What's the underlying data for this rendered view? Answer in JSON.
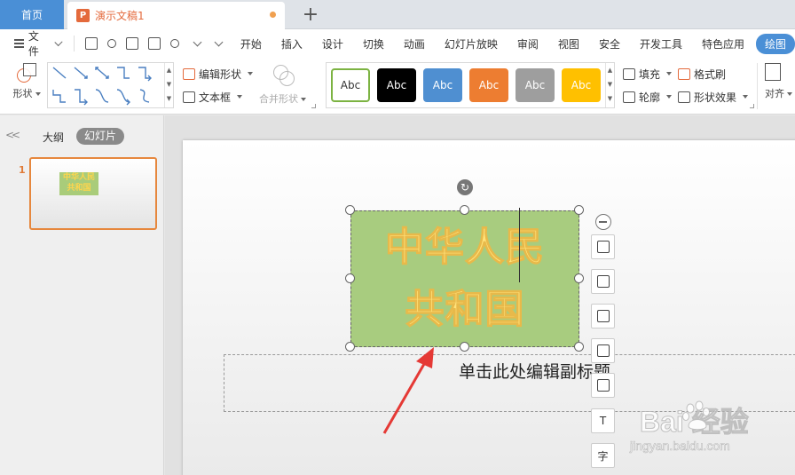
{
  "tabs": {
    "home_label": "首页",
    "doc_icon_letter": "P",
    "doc_title": "演示文稿1",
    "add_tab": "+"
  },
  "menubar": {
    "file_label": "文件",
    "items": [
      "开始",
      "插入",
      "设计",
      "切换",
      "动画",
      "幻灯片放映",
      "审阅",
      "视图",
      "安全",
      "开发工具",
      "特色应用"
    ],
    "active_item": "绘图"
  },
  "ribbon": {
    "shape_label": "形状",
    "edit_shape_label": "编辑形状",
    "textbox_label": "文本框",
    "merge_shape_label": "合并形状",
    "style_swatches": [
      {
        "label": "Abc",
        "bg": "#ffffff",
        "fg": "#333333",
        "border": "#7cb342"
      },
      {
        "label": "Abc",
        "bg": "#000000",
        "fg": "#ffffff",
        "border": "#000000"
      },
      {
        "label": "Abc",
        "bg": "#4f8fd1",
        "fg": "#ffffff",
        "border": "#4f8fd1"
      },
      {
        "label": "Abc",
        "bg": "#ed7d31",
        "fg": "#ffffff",
        "border": "#ed7d31"
      },
      {
        "label": "Abc",
        "bg": "#9e9e9e",
        "fg": "#ffffff",
        "border": "#9e9e9e"
      },
      {
        "label": "Abc",
        "bg": "#ffc000",
        "fg": "#ffffff",
        "border": "#ffc000"
      }
    ],
    "fill_label": "填充",
    "outline_label": "轮廓",
    "format_brush_label": "格式刷",
    "shape_effect_label": "形状效果",
    "align_label": "对齐"
  },
  "leftpanel": {
    "outline_tab": "大纲",
    "slides_tab": "幻灯片",
    "slide_number": "1",
    "thumb_line1": "中华人民",
    "thumb_line2": "共和国"
  },
  "slide": {
    "title_line1": "中华人民",
    "title_line2": "共和国",
    "subtitle_placeholder": "单击此处编辑副标题"
  },
  "float_tools": {
    "text_tool_glyph": "T",
    "char_tool_glyph": "字"
  },
  "watermark": {
    "brand": "Bai  经验",
    "url": "jingyan.baidu.com"
  },
  "colors": {
    "accent": "#4a8fd6",
    "doc_orange": "#e46a3c",
    "title_fill": "#a8cc7f",
    "title_text": "#ffe27a",
    "arrow": "#e53935"
  }
}
